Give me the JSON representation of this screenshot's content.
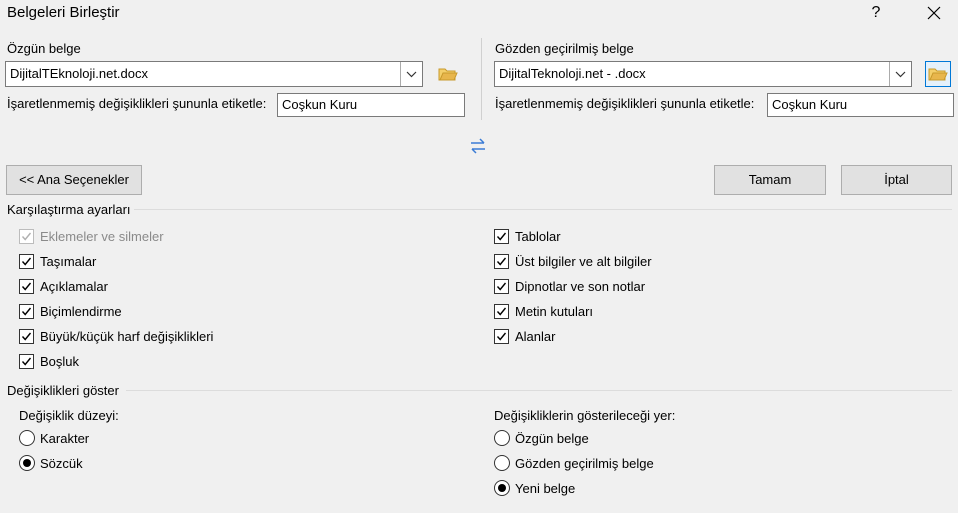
{
  "window": {
    "title": "Belgeleri Birleştir",
    "help": "?",
    "close": "✕"
  },
  "original": {
    "heading": "Özgün belge",
    "file": "DijitalTEknoloji.net.docx",
    "label_caption": "İşaretlenmemiş değişiklikleri şununla etiketle:",
    "label_value": "Coşkun Kuru"
  },
  "revised": {
    "heading": "Gözden geçirilmiş belge",
    "file": "DijitalTeknoloji.net - .docx",
    "label_caption": "İşaretlenmemiş değişiklikleri şununla etiketle:",
    "label_value": "Coşkun Kuru"
  },
  "buttons": {
    "less": "<< Ana Seçenekler",
    "ok": "Tamam",
    "cancel": "İptal"
  },
  "comparison": {
    "title": "Karşılaştırma ayarları",
    "left": [
      {
        "label": "Eklemeler ve silmeler",
        "checked": true,
        "disabled": true
      },
      {
        "label": "Taşımalar",
        "checked": true
      },
      {
        "label": "Açıklamalar",
        "checked": true
      },
      {
        "label": "Biçimlendirme",
        "checked": true
      },
      {
        "label": "Büyük/küçük harf değişiklikleri",
        "checked": true
      },
      {
        "label": "Boşluk",
        "checked": true
      }
    ],
    "right": [
      {
        "label": "Tablolar",
        "checked": true
      },
      {
        "label": "Üst bilgiler ve alt bilgiler",
        "checked": true
      },
      {
        "label": "Dipnotlar ve son notlar",
        "checked": true
      },
      {
        "label": "Metin kutuları",
        "checked": true
      },
      {
        "label": "Alanlar",
        "checked": true
      }
    ]
  },
  "show": {
    "title": "Değişiklikleri göster",
    "level_title": "Değişiklik düzeyi:",
    "level_options": [
      {
        "label": "Karakter",
        "selected": false
      },
      {
        "label": "Sözcük",
        "selected": true
      }
    ],
    "where_title": "Değişikliklerin gösterileceği yer:",
    "where_options": [
      {
        "label": "Özgün belge",
        "selected": false
      },
      {
        "label": "Gözden geçirilmiş belge",
        "selected": false
      },
      {
        "label": "Yeni belge",
        "selected": true
      }
    ]
  },
  "icons": {
    "folder": "folder-open-icon",
    "swap": "swap-arrows-icon",
    "dropdown": "chevron-down-icon"
  },
  "colors": {
    "accent": "#0078d7",
    "folder": "#e8b64c"
  }
}
